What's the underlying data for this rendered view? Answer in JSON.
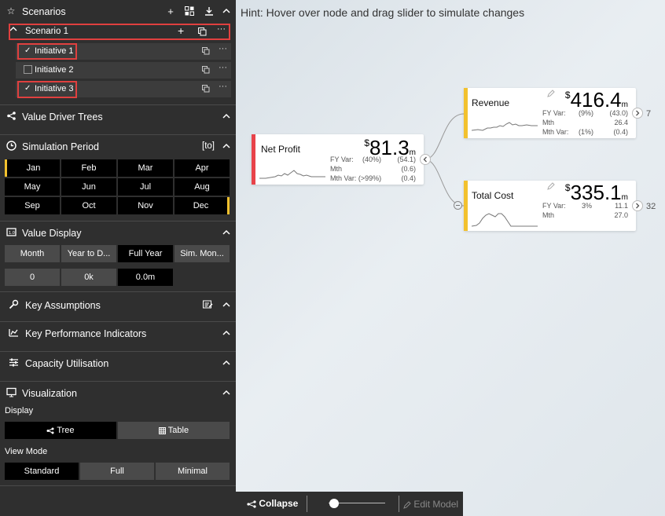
{
  "hint": "Hint: Hover over node and drag slider to simulate changes",
  "scenarios": {
    "title": "Scenarios",
    "scenario": {
      "label": "Scenario 1"
    },
    "initiatives": [
      {
        "label": "Initiative 1",
        "checked": true
      },
      {
        "label": "Initiative 2",
        "checked": false
      },
      {
        "label": "Initiative 3",
        "checked": true
      }
    ]
  },
  "value_driver_trees": {
    "title": "Value Driver Trees"
  },
  "simulation_period": {
    "title": "Simulation Period",
    "tag": "[to]",
    "months": [
      "Jan",
      "Feb",
      "Mar",
      "Apr",
      "May",
      "Jun",
      "Jul",
      "Aug",
      "Sep",
      "Oct",
      "Nov",
      "Dec"
    ]
  },
  "value_display": {
    "title": "Value Display",
    "modes": [
      "Month",
      "Year to D...",
      "Full Year",
      "Sim. Mon..."
    ],
    "selected_mode": "Full Year",
    "formats": [
      "0",
      "0k",
      "0.0m"
    ],
    "selected_format": "0.0m"
  },
  "key_assumptions": {
    "title": "Key Assumptions"
  },
  "kpi": {
    "title": "Key Performance Indicators"
  },
  "capacity": {
    "title": "Capacity Utilisation"
  },
  "visualization": {
    "title": "Visualization",
    "display_label": "Display",
    "display_options": [
      "Tree",
      "Table"
    ],
    "selected_display": "Tree",
    "view_mode_label": "View Mode",
    "view_modes": [
      "Standard",
      "Full",
      "Minimal"
    ],
    "selected_view_mode": "Standard"
  },
  "nodes": {
    "net_profit": {
      "name": "Net Profit",
      "currency": "$",
      "value": "81.3",
      "unit": "m",
      "accent": "#e8434a",
      "rows": [
        {
          "label": "FY Var:",
          "pct": "(40%)",
          "value": "(54.1)"
        },
        {
          "label": "Mth",
          "pct": "",
          "value": "(0.6)"
        },
        {
          "label": "Mth Var: (>99%)",
          "pct": "",
          "value": "(0.4)"
        }
      ]
    },
    "revenue": {
      "name": "Revenue",
      "currency": "$",
      "value": "416.4",
      "unit": "m",
      "accent": "#f2c12e",
      "child_count": "7",
      "rows": [
        {
          "label": "FY Var:",
          "pct": "(9%)",
          "value": "(43.0)"
        },
        {
          "label": "Mth",
          "pct": "",
          "value": "26.4"
        },
        {
          "label": "Mth Var:",
          "pct": "(1%)",
          "value": "(0.4)"
        }
      ]
    },
    "total_cost": {
      "name": "Total Cost",
      "currency": "$",
      "value": "335.1",
      "unit": "m",
      "accent": "#f2c12e",
      "child_count": "32",
      "rows": [
        {
          "label": "FY Var:",
          "pct": "3%",
          "value": "11.1"
        },
        {
          "label": "Mth",
          "pct": "",
          "value": "27.0"
        }
      ]
    }
  },
  "toolbar": {
    "collapse_label": "Collapse",
    "edit_model_label": "Edit Model",
    "zoom_level": 0.1
  }
}
